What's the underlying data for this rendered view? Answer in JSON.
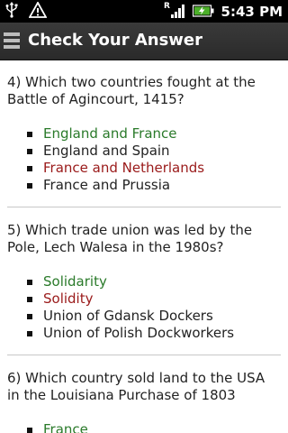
{
  "status_bar": {
    "time": "5:43 PM",
    "icons": [
      "usb-icon",
      "warning-icon",
      "roaming-icon",
      "signal-icon",
      "battery-charging-icon"
    ],
    "roaming_letter": "R"
  },
  "header": {
    "title": "Check Your Answer",
    "menu_icon": "menu-icon"
  },
  "colors": {
    "correct": "#2a7a2a",
    "wrong": "#9a1a1a",
    "neutral": "#222222"
  },
  "questions": [
    {
      "text": "4) Which two countries fought at the Battle of Agincourt, 1415?",
      "answers": [
        {
          "label": "England and France",
          "status": "correct"
        },
        {
          "label": "England and Spain",
          "status": "neutral"
        },
        {
          "label": "France and Netherlands",
          "status": "wrong"
        },
        {
          "label": "France and Prussia",
          "status": "neutral"
        }
      ]
    },
    {
      "text": "5) Which trade union was led by the Pole, Lech Walesa in the 1980s?",
      "answers": [
        {
          "label": "Solidarity",
          "status": "correct"
        },
        {
          "label": "Solidity",
          "status": "wrong"
        },
        {
          "label": "Union of Gdansk Dockers",
          "status": "neutral"
        },
        {
          "label": "Union of Polish Dockworkers",
          "status": "neutral"
        }
      ]
    },
    {
      "text": "6) Which country sold land to the USA in the Louisiana Purchase of 1803",
      "answers": [
        {
          "label": "France",
          "status": "correct"
        }
      ]
    }
  ]
}
